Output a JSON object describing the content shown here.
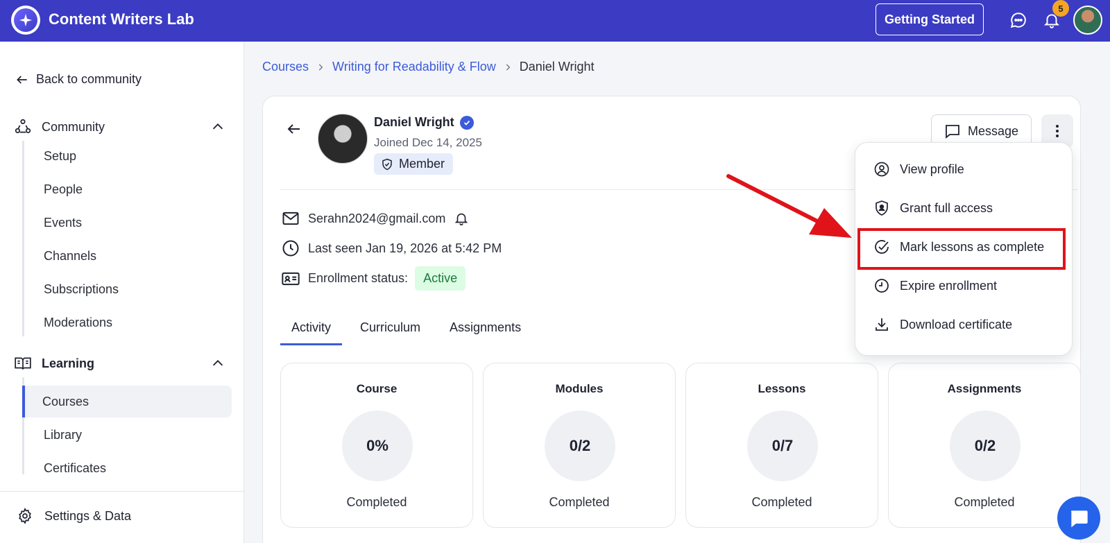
{
  "app": {
    "title": "Content Writers Lab",
    "accent_color": "#3b3bc4",
    "link_color": "#3b5bdb"
  },
  "header": {
    "getting_started_label": "Getting Started",
    "chat_icon": "chat-bubble-icon",
    "notifications_icon": "bell-icon",
    "notification_count": "5"
  },
  "sidebar": {
    "back_label": "Back to community",
    "community": {
      "label": "Community",
      "items": [
        {
          "label": "Setup"
        },
        {
          "label": "People"
        },
        {
          "label": "Events"
        },
        {
          "label": "Channels"
        },
        {
          "label": "Subscriptions"
        },
        {
          "label": "Moderations"
        }
      ]
    },
    "learning": {
      "label": "Learning",
      "items": [
        {
          "label": "Courses",
          "active": true
        },
        {
          "label": "Library"
        },
        {
          "label": "Certificates"
        }
      ]
    },
    "settings_label": "Settings & Data"
  },
  "breadcrumb": {
    "items": [
      "Courses",
      "Writing for Readability & Flow",
      "Daniel Wright"
    ]
  },
  "profile": {
    "name": "Daniel Wright",
    "joined": "Joined Dec 14, 2025",
    "role": "Member",
    "email": "Serahn2024@gmail.com",
    "last_seen": "Last seen Jan 19, 2026 at 5:42 PM",
    "enrollment_label": "Enrollment status:",
    "enrollment_status": "Active",
    "status_color": "#dcfce4"
  },
  "actions": {
    "message_label": "Message"
  },
  "dropdown": {
    "items": [
      {
        "label": "View profile",
        "icon": "user-circle-icon"
      },
      {
        "label": "Grant full access",
        "icon": "shield-user-icon"
      },
      {
        "label": "Mark lessons as complete",
        "icon": "check-circle-icon",
        "highlighted": true
      },
      {
        "label": "Expire enrollment",
        "icon": "clock-icon"
      },
      {
        "label": "Download certificate",
        "icon": "download-icon"
      }
    ],
    "highlight_color": "#e0131a"
  },
  "tabs": [
    "Activity",
    "Curriculum",
    "Assignments"
  ],
  "active_tab": "Activity",
  "stats": [
    {
      "title": "Course",
      "value": "0%",
      "label": "Completed"
    },
    {
      "title": "Modules",
      "value": "0/2",
      "label": "Completed"
    },
    {
      "title": "Lessons",
      "value": "0/7",
      "label": "Completed"
    },
    {
      "title": "Assignments",
      "value": "0/2",
      "label": "Completed"
    }
  ]
}
